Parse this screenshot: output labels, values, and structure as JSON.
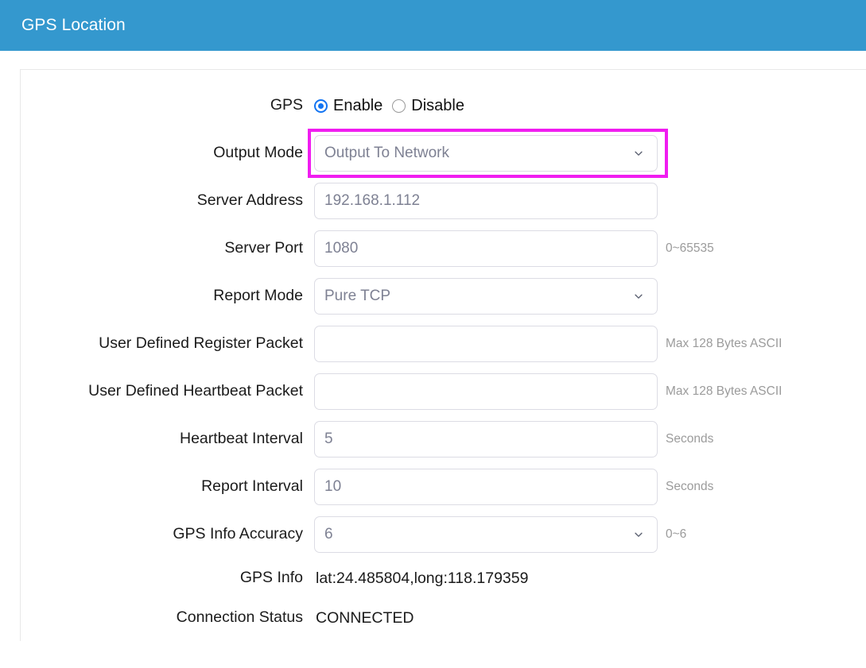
{
  "header": {
    "title": "GPS Location"
  },
  "form": {
    "gps": {
      "label": "GPS",
      "options": [
        {
          "label": "Enable",
          "selected": true
        },
        {
          "label": "Disable",
          "selected": false
        }
      ]
    },
    "output_mode": {
      "label": "Output Mode",
      "value": "Output To Network",
      "highlighted": true,
      "icon": "chevron-down-icon"
    },
    "server_address": {
      "label": "Server Address",
      "value": "192.168.1.112",
      "hint": ""
    },
    "server_port": {
      "label": "Server Port",
      "value": "1080",
      "hint": "0~65535"
    },
    "report_mode": {
      "label": "Report Mode",
      "value": "Pure TCP",
      "icon": "chevron-down-icon"
    },
    "register_packet": {
      "label": "User Defined Register Packet",
      "value": "",
      "hint": "Max 128 Bytes ASCII"
    },
    "heartbeat_packet": {
      "label": "User Defined Heartbeat Packet",
      "value": "",
      "hint": "Max 128 Bytes ASCII"
    },
    "heartbeat_interval": {
      "label": "Heartbeat Interval",
      "value": "5",
      "hint": "Seconds"
    },
    "report_interval": {
      "label": "Report Interval",
      "value": "10",
      "hint": "Seconds"
    },
    "gps_accuracy": {
      "label": "GPS Info Accuracy",
      "value": "6",
      "hint": "0~6",
      "icon": "chevron-down-icon"
    },
    "gps_info": {
      "label": "GPS Info",
      "value": "lat:24.485804,long:118.179359"
    },
    "connection_status": {
      "label": "Connection Status",
      "value": "CONNECTED"
    }
  },
  "colors": {
    "header_blue": "#3498ce",
    "highlight_magenta": "#f01df0",
    "radio_blue": "#1374f2",
    "input_text": "#7e8193",
    "hint_text": "#9b9b9b"
  }
}
